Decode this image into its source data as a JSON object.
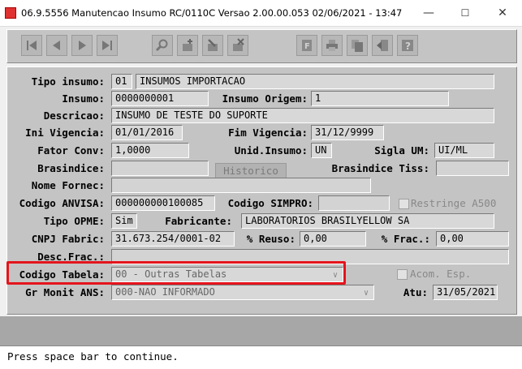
{
  "window": {
    "title": "06.9.5556 Manutencao  Insumo RC/0110C Versao 2.00.00.053 02/06/2021 - 13:47",
    "minimize": "—",
    "maximize": "☐",
    "close": "✕"
  },
  "toolbar": {
    "icons": [
      "first-record-icon",
      "previous-record-icon",
      "next-record-icon",
      "last-record-icon",
      "search-icon",
      "add-icon",
      "edit-icon",
      "delete-icon",
      "filter-icon",
      "print-icon",
      "copy-icon",
      "exit-icon",
      "help-icon"
    ]
  },
  "form": {
    "tipo_insumo": {
      "label": "Tipo insumo:",
      "code": "01",
      "desc": "INSUMOS IMPORTACAO"
    },
    "insumo": {
      "label": "Insumo:",
      "value": "0000000001"
    },
    "insumo_origem": {
      "label": "Insumo Origem:",
      "value": "1"
    },
    "descricao": {
      "label": "Descricao:",
      "value": "INSUMO DE TESTE DO SUPORTE"
    },
    "ini_vigencia": {
      "label": "Ini Vigencia:",
      "value": "01/01/2016"
    },
    "fim_vigencia": {
      "label": "Fim Vigencia:",
      "value": "31/12/9999"
    },
    "fator_conv": {
      "label": "Fator Conv:",
      "value": "1,0000"
    },
    "unid_insumo": {
      "label": "Unid.Insumo:",
      "value": "UN"
    },
    "sigla_um": {
      "label": "Sigla UM:",
      "value": "UI/ML"
    },
    "brasindice": {
      "label": "Brasindice:",
      "value": ""
    },
    "historico_button": "Historico",
    "brasindice_tiss": {
      "label": "Brasindice Tiss:",
      "value": ""
    },
    "nome_fornec": {
      "label": "Nome Fornec:",
      "value": ""
    },
    "codigo_anvisa": {
      "label": "Codigo ANVISA:",
      "value": "000000000100085"
    },
    "codigo_simpro": {
      "label": "Codigo SIMPRO:",
      "value": ""
    },
    "restringe_a500": {
      "label": "Restringe A500",
      "checked": false
    },
    "tipo_opme": {
      "label": "Tipo OPME:",
      "value": "Sim"
    },
    "fabricante": {
      "label": "Fabricante:",
      "value": "LABORATORIOS BRASILYELLOW SA"
    },
    "cnpj_fabric": {
      "label": "CNPJ Fabric:",
      "value": "31.673.254/0001-02"
    },
    "perc_reuso": {
      "label": "% Reuso:",
      "value": "0,00"
    },
    "perc_frac": {
      "label": "% Frac.:",
      "value": "0,00"
    },
    "desc_frac": {
      "label": "Desc.Frac.:",
      "value": ""
    },
    "codigo_tabela": {
      "label": "Codigo Tabela:",
      "value": "00 - Outras Tabelas"
    },
    "acom_esp": {
      "label": "Acom. Esp.",
      "checked": false
    },
    "gr_monit_ans": {
      "label": "Gr Monit ANS:",
      "value": "000-NAO INFORMADO"
    },
    "atu": {
      "label": "Atu:",
      "value": "31/05/2021"
    }
  },
  "status": {
    "message": "Press space bar to continue."
  },
  "colors": {
    "highlight": "#e4141c",
    "form_bg": "#c4c4c4",
    "field_bg": "#d8d8d8"
  }
}
